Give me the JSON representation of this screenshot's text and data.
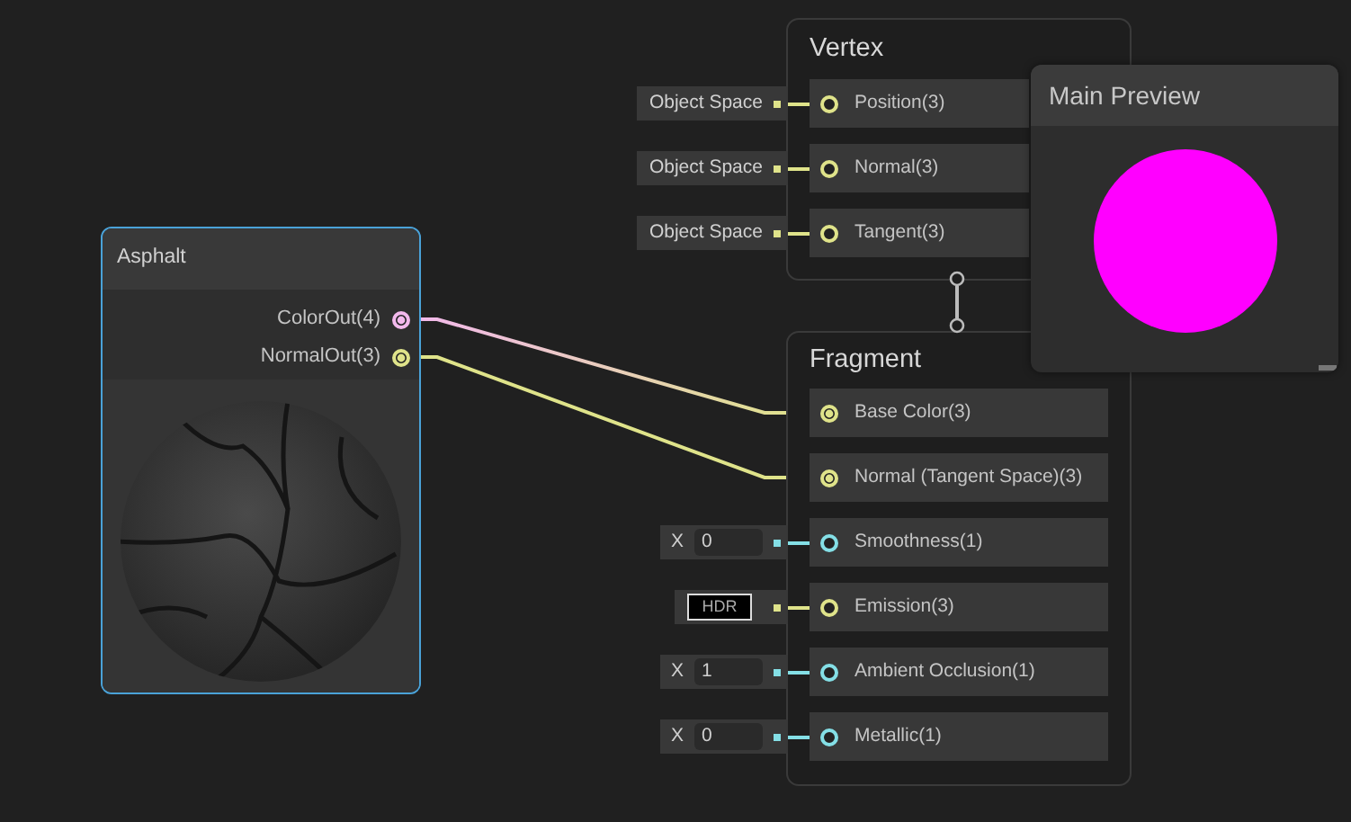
{
  "graph_node": {
    "title": "Asphalt",
    "selected": true,
    "outputs": [
      {
        "label": "ColorOut(4)",
        "color": "#f2b8ec",
        "connected": true
      },
      {
        "label": "NormalOut(3)",
        "color": "#dfe38a",
        "connected": true
      }
    ]
  },
  "vertex": {
    "title": "Vertex",
    "slots": [
      {
        "label": "Position(3)",
        "color": "#dfe38a",
        "connected": false,
        "input": {
          "kind": "dropdown",
          "value": "Object Space"
        }
      },
      {
        "label": "Normal(3)",
        "color": "#dfe38a",
        "connected": false,
        "input": {
          "kind": "dropdown",
          "value": "Object Space"
        }
      },
      {
        "label": "Tangent(3)",
        "color": "#dfe38a",
        "connected": false,
        "input": {
          "kind": "dropdown",
          "value": "Object Space"
        }
      }
    ]
  },
  "fragment": {
    "title": "Fragment",
    "slots": [
      {
        "label": "Base Color(3)",
        "color": "#dfe38a",
        "connected": true
      },
      {
        "label": "Normal (Tangent Space)(3)",
        "color": "#dfe38a",
        "connected": true
      },
      {
        "label": "Smoothness(1)",
        "color": "#84dfe6",
        "connected": false,
        "input": {
          "kind": "float",
          "axis": "X",
          "value": "0"
        }
      },
      {
        "label": "Emission(3)",
        "color": "#dfe38a",
        "connected": false,
        "input": {
          "kind": "color",
          "value": "HDR"
        }
      },
      {
        "label": "Ambient Occlusion(1)",
        "color": "#84dfe6",
        "connected": false,
        "input": {
          "kind": "float",
          "axis": "X",
          "value": "1"
        }
      },
      {
        "label": "Metallic(1)",
        "color": "#84dfe6",
        "connected": false,
        "input": {
          "kind": "float",
          "axis": "X",
          "value": "0"
        }
      }
    ]
  },
  "main_preview": {
    "title": "Main Preview"
  }
}
